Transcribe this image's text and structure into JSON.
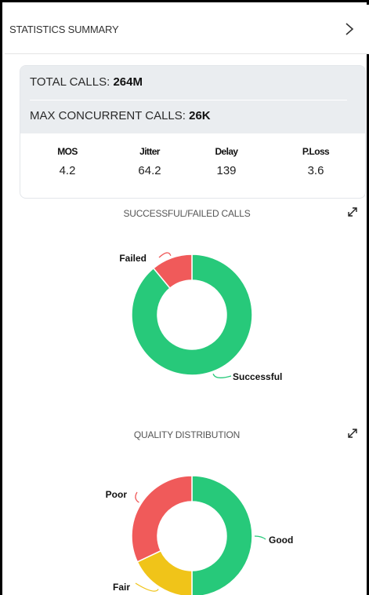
{
  "header": {
    "title": "STATISTICS SUMMARY",
    "chevron_icon": "chevron-right-icon"
  },
  "summary": {
    "total_calls_label": "TOTAL CALLS:",
    "total_calls_value": "264M",
    "max_concurrent_label": "MAX CONCURRENT CALLS:",
    "max_concurrent_value": "26K",
    "metrics": [
      {
        "label": "MOS",
        "value": "4.2"
      },
      {
        "label": "Jitter",
        "value": "64.2"
      },
      {
        "label": "Delay",
        "value": "139"
      },
      {
        "label": "P.Loss",
        "value": "3.6"
      }
    ]
  },
  "expand_icon": "expand-arrows-icon",
  "chart_data": [
    {
      "type": "pie",
      "style": "donut",
      "title": "SUCCESSFUL/FAILED CALLS",
      "categories": [
        "Successful",
        "Failed"
      ],
      "values": [
        89,
        11
      ],
      "colors": [
        "#27c97a",
        "#f05a5a"
      ],
      "legend": "none"
    },
    {
      "type": "pie",
      "style": "donut",
      "title": "QUALITY DISTRIBUTION",
      "categories": [
        "Good",
        "Fair",
        "Poor"
      ],
      "values": [
        50,
        18,
        32
      ],
      "colors": [
        "#27c97a",
        "#f0c419",
        "#f05a5a"
      ],
      "legend": "none"
    }
  ]
}
